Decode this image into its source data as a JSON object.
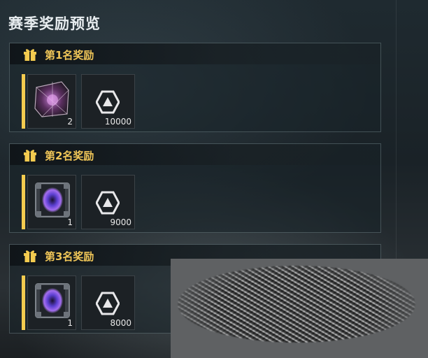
{
  "header": {
    "title": "赛季奖励预览"
  },
  "panels": [
    {
      "title": "第1名奖励",
      "item": {
        "icon": "crystal-cube-icon",
        "count": "2"
      },
      "currency": {
        "icon": "hexagon-triangle-currency-icon",
        "amount": "10000"
      }
    },
    {
      "title": "第2名奖励",
      "item": {
        "icon": "portal-chest-icon",
        "count": "1"
      },
      "currency": {
        "icon": "hexagon-triangle-currency-icon",
        "amount": "9000"
      }
    },
    {
      "title": "第3名奖励",
      "item": {
        "icon": "portal-chest-icon",
        "count": "1"
      },
      "currency": {
        "icon": "hexagon-triangle-currency-icon",
        "amount": "8000"
      }
    }
  ],
  "colors": {
    "accent_gold": "#f3cb4f",
    "title_gold": "#f0c658",
    "panel_border": "#a0b4b9"
  }
}
